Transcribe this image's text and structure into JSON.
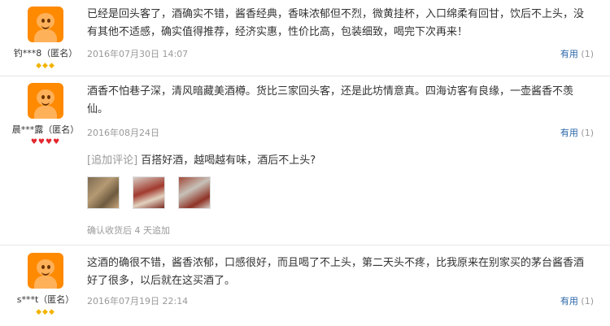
{
  "reviews": [
    {
      "user": "钓***8（匿名）",
      "badge": "gold",
      "badge_glyphs": "◆◆◆",
      "content": "已经是回头客了，酒确实不错，酱香经典，香味浓郁但不烈，微黄挂杯，入口绵柔有回甘，饮后不上头，没有其他不适感，确实值得推荐，经济实惠，性价比高，包装细致，喝完下次再来！",
      "date": "2016年07月30日 14:07",
      "useful_label": "有用",
      "useful_count": "(1)"
    },
    {
      "user": "晨***露（匿名）",
      "badge": "red",
      "badge_glyphs": "♥♥♥♥",
      "content": "酒香不怕巷子深，清风暗藏美酒樽。货比三家回头客，还是此坊情意真。四海访客有良缘，一壶酱香不羡仙。",
      "date": "2016年08月24日",
      "useful_label": "有用",
      "useful_count": "(1)",
      "append_tag": "[追加评论]",
      "append_text": "百搭好酒，越喝越有味，酒后不上头?",
      "append_meta": "确认收货后 4 天追加"
    },
    {
      "user": "s***t（匿名）",
      "badge": "gold",
      "badge_glyphs": "◆◆◆",
      "content": "这酒的确很不错，酱香浓郁，口感很好，而且喝了不上头，第二天头不疼，比我原来在别家买的茅台酱香酒好了很多，以后就在这买酒了。",
      "date": "2016年07月19日 22:14",
      "useful_label": "有用",
      "useful_count": "(1)"
    }
  ],
  "colors": {
    "gold_badge": "#f2b300",
    "red_badge": "#e4262d",
    "link": "#2a65a8",
    "meta": "#999999"
  }
}
